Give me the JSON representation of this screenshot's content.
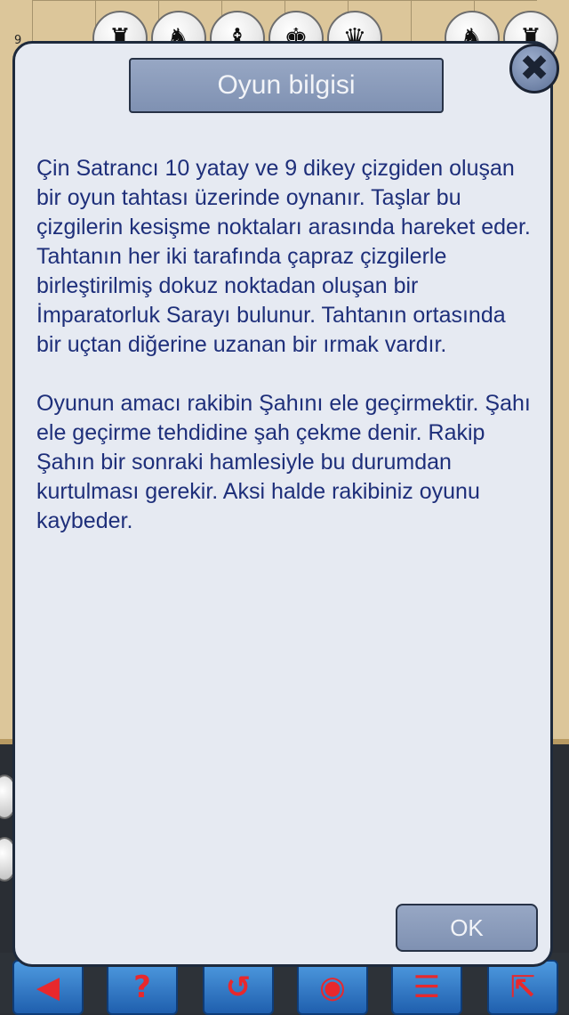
{
  "board": {
    "row_label": "9",
    "pieces": [
      {
        "icon": "chariot-icon",
        "glyph": "♜"
      },
      {
        "icon": "horse-icon",
        "glyph": "♞"
      },
      {
        "icon": "elephant-icon",
        "glyph": "♝"
      },
      {
        "icon": "advisor-icon",
        "glyph": "♚"
      },
      {
        "icon": "general-icon",
        "glyph": "♛"
      },
      {
        "icon": "horse-icon",
        "glyph": "♞"
      },
      {
        "icon": "chariot-icon",
        "glyph": "♜"
      }
    ]
  },
  "dialog": {
    "title": "Oyun bilgisi",
    "close_glyph": "✖",
    "paragraph_1": "Çin Satrancı 10 yatay ve 9 dikey çizgiden oluşan bir oyun tahtası üzerinde oynanır. Taşlar bu çizgilerin kesişme noktaları arasında hareket eder. Tahtanın her iki tarafında çapraz çizgilerle birleştirilmiş dokuz noktadan oluşan bir İmparatorluk Sarayı bulunur. Tahtanın ortasında bir uçtan diğerine uzanan bir ırmak vardır.",
    "paragraph_2": "Oyunun amacı rakibin Şahını ele geçirmektir. Şahı ele geçirme tehdidine şah çekme denir. Rakip Şahın bir sonraki hamlesiyle bu durumdan kurtulması gerekir. Aksi halde rakibiniz oyunu kaybeder.",
    "ok_label": "OK"
  },
  "toolbar": {
    "buttons": [
      {
        "icon": "back-arrow-icon",
        "glyph": "◀"
      },
      {
        "icon": "help-icon",
        "glyph": "?"
      },
      {
        "icon": "undo-icon",
        "glyph": "↺"
      },
      {
        "icon": "eye-icon",
        "glyph": "◉"
      },
      {
        "icon": "menu-icon",
        "glyph": "☰"
      },
      {
        "icon": "exit-icon",
        "glyph": "⇱"
      }
    ]
  }
}
